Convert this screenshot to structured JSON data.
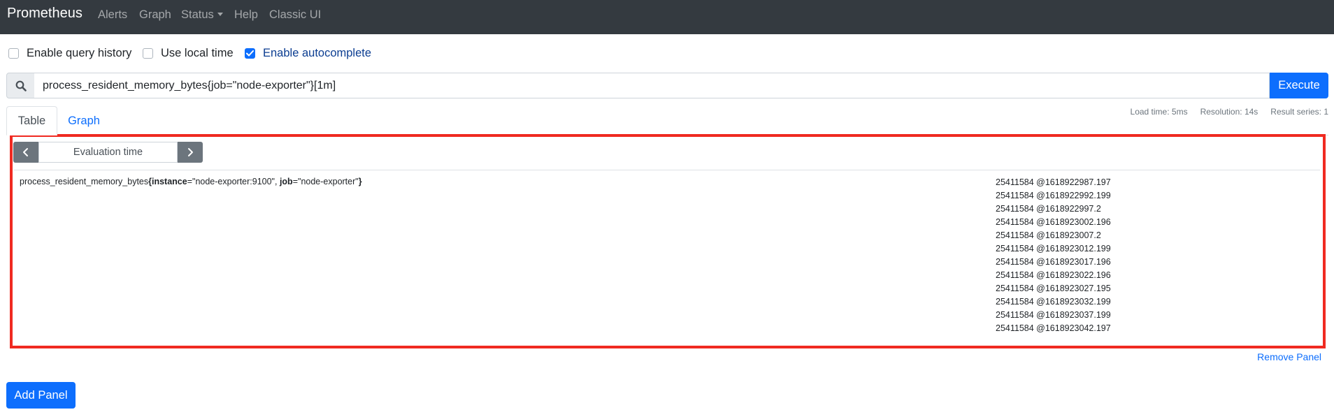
{
  "navbar": {
    "brand": "Prometheus",
    "links": [
      "Alerts",
      "Graph",
      "Status",
      "Help",
      "Classic UI"
    ]
  },
  "options": [
    {
      "label": "Enable query history",
      "checked": false
    },
    {
      "label": "Use local time",
      "checked": false
    },
    {
      "label": "Enable autocomplete",
      "checked": true
    }
  ],
  "query": {
    "icon": "search-icon",
    "value": "process_resident_memory_bytes{job=\"node-exporter\"}[1m]",
    "execute_label": "Execute"
  },
  "tabs": [
    {
      "label": "Table",
      "active": true
    },
    {
      "label": "Graph",
      "active": false
    }
  ],
  "stats": {
    "load_time": "Load time: 5ms",
    "resolution": "Resolution: 14s",
    "result_series": "Result series: 1"
  },
  "eval": {
    "label": "Evaluation time",
    "prev_icon": "chevron-left-icon",
    "next_icon": "chevron-right-icon"
  },
  "result": {
    "metric": "process_resident_memory_bytes",
    "open_brace": "{",
    "label1_key": "instance",
    "label1_value": "=\"node-exporter:9100\", ",
    "label2_key": "job",
    "label2_value": "=\"node-exporter\"",
    "close_brace": "}",
    "values": [
      "25411584 @1618922987.197",
      "25411584 @1618922992.199",
      "25411584 @1618922997.2",
      "25411584 @1618923002.196",
      "25411584 @1618923007.2",
      "25411584 @1618923012.199",
      "25411584 @1618923017.196",
      "25411584 @1618923022.196",
      "25411584 @1618923027.195",
      "25411584 @1618923032.199",
      "25411584 @1618923037.199",
      "25411584 @1618923042.197"
    ]
  },
  "remove_panel_label": "Remove Panel",
  "add_panel_label": "Add Panel",
  "colors": {
    "navbar": "#343a40",
    "primary": "#0d6efd",
    "highlight_border": "#f02a21",
    "secondary": "#6c757d"
  }
}
